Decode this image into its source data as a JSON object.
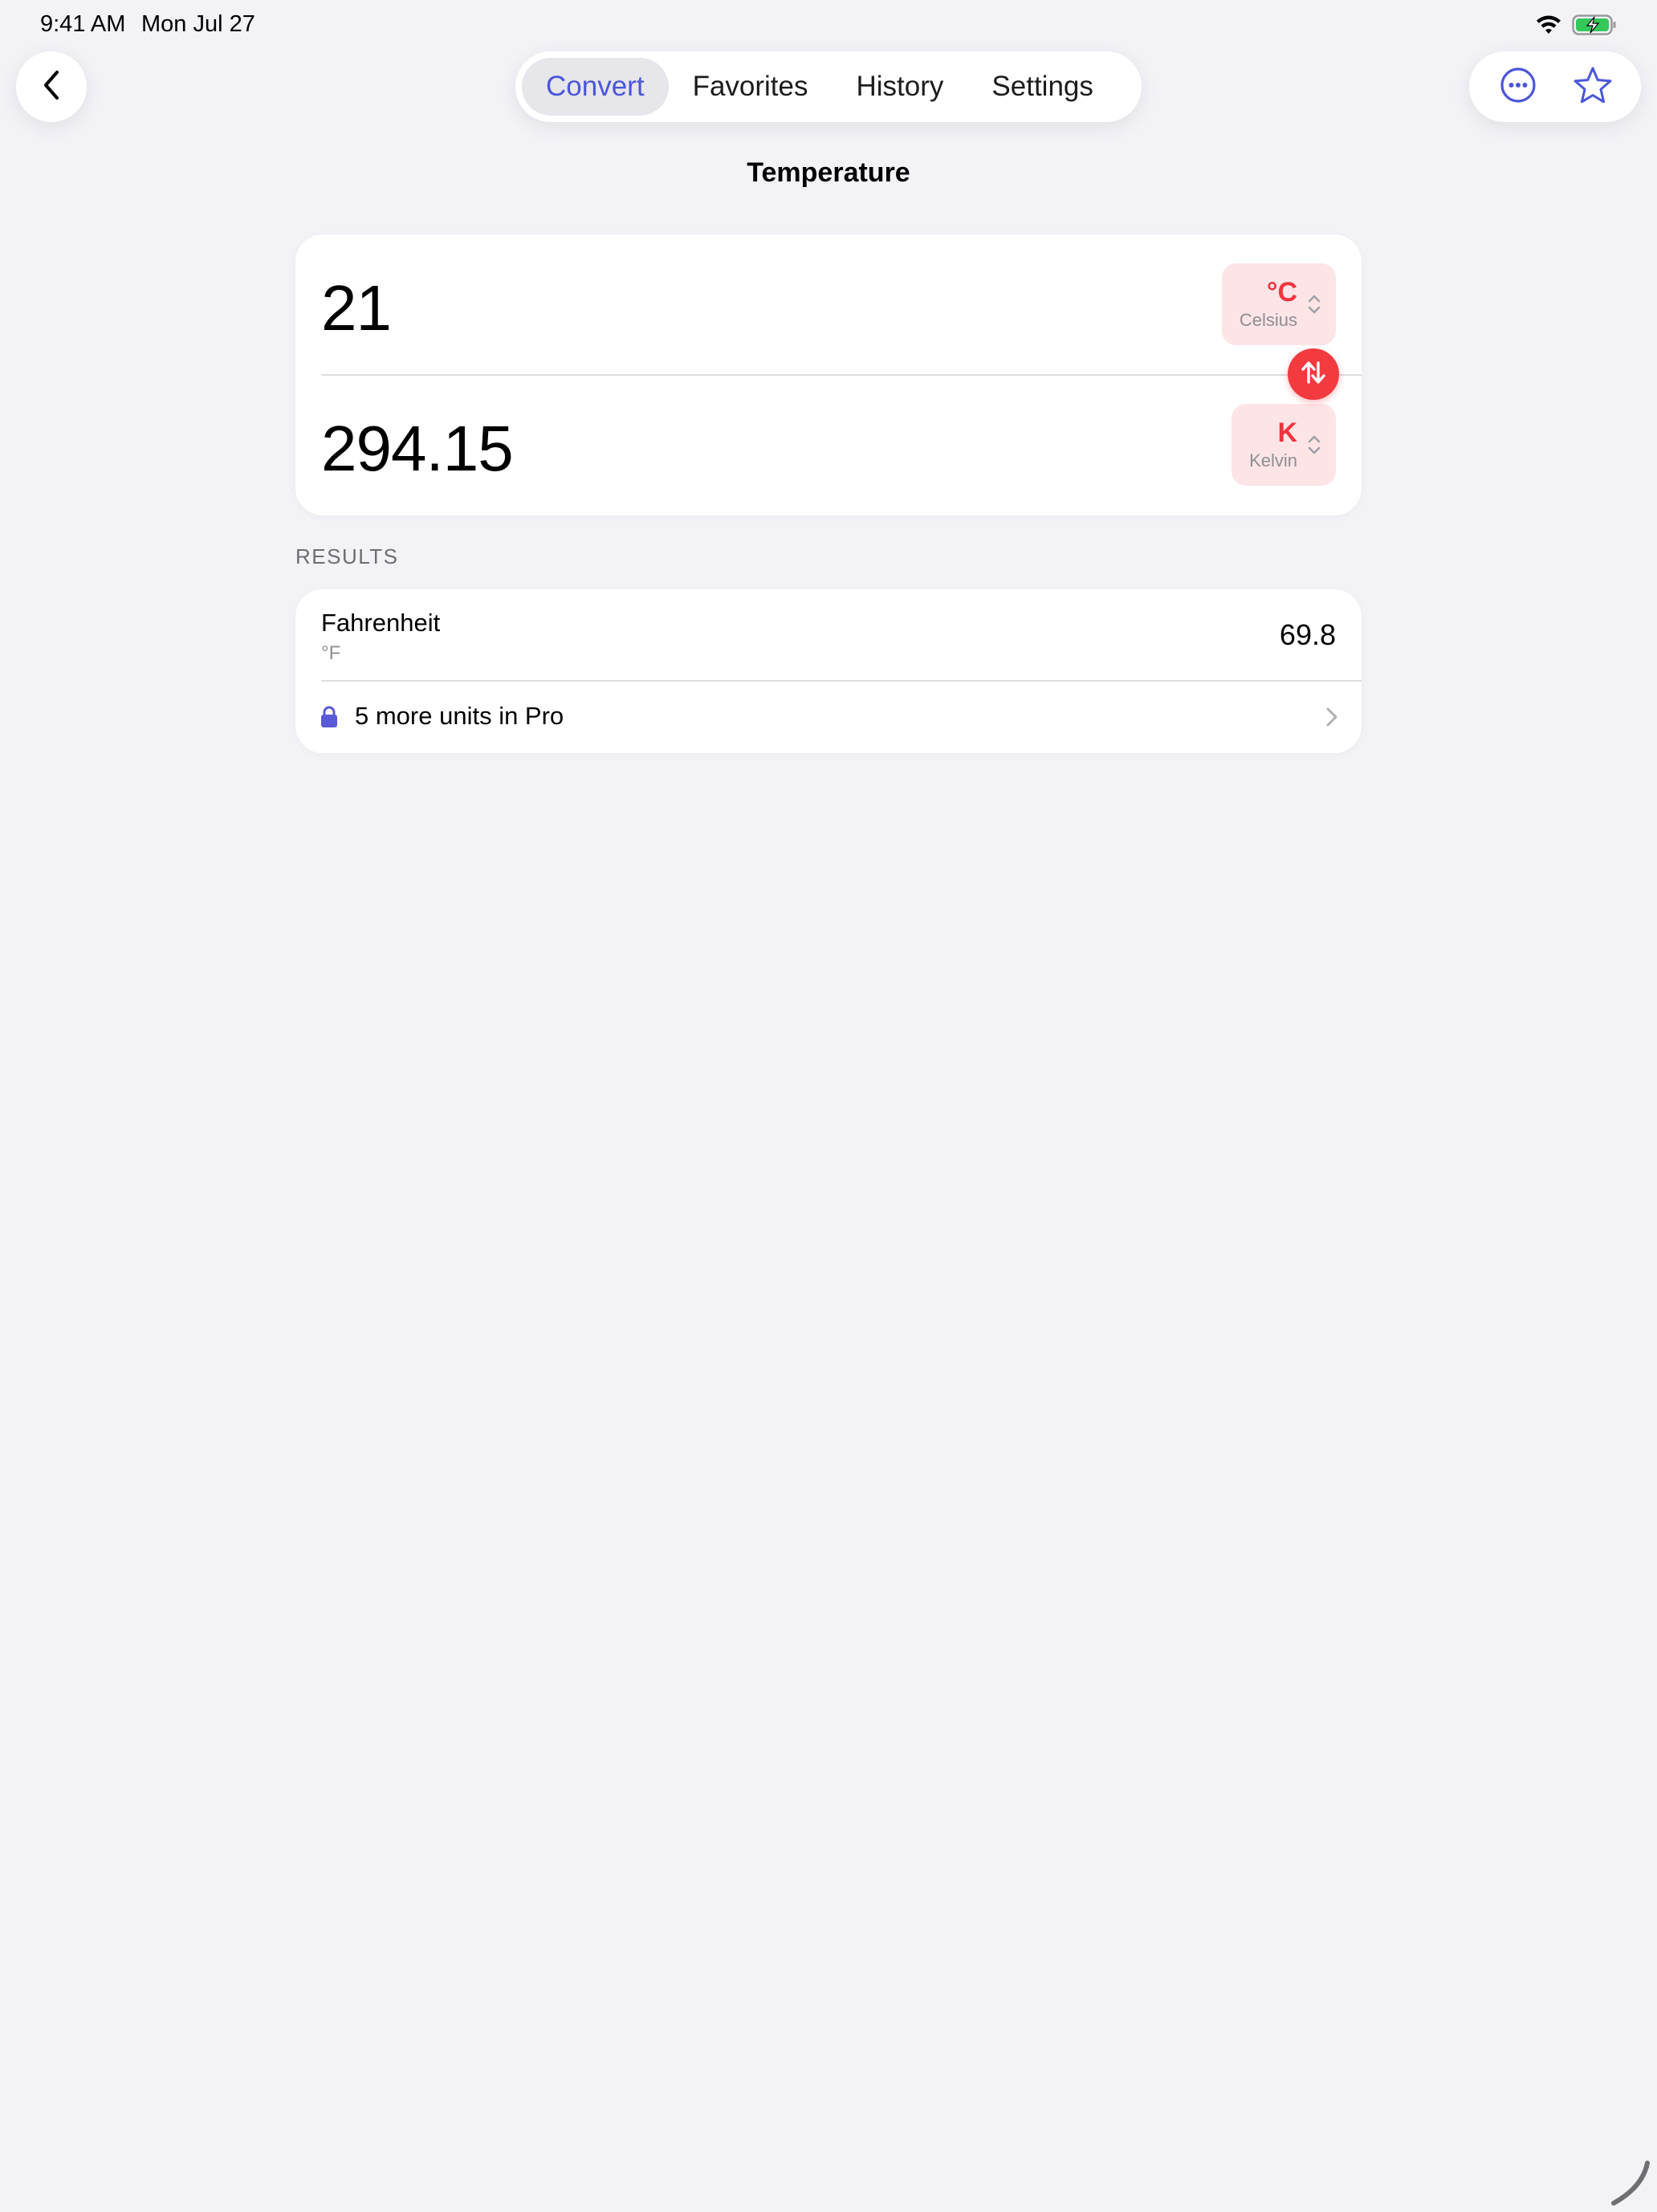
{
  "status_bar": {
    "time": "9:41 AM",
    "date": "Mon Jul 27"
  },
  "nav": {
    "tabs": [
      {
        "label": "Convert",
        "active": true
      },
      {
        "label": "Favorites",
        "active": false
      },
      {
        "label": "History",
        "active": false
      },
      {
        "label": "Settings",
        "active": false
      }
    ],
    "back_icon": "chevron-left-icon",
    "more_icon": "ellipsis-circle-icon",
    "favorite_icon": "star-icon"
  },
  "page": {
    "title": "Temperature"
  },
  "converter": {
    "input": {
      "value": "21",
      "unit_symbol": "°C",
      "unit_name": "Celsius"
    },
    "output": {
      "value": "294.15",
      "unit_symbol": "K",
      "unit_name": "Kelvin"
    },
    "swap_icon": "arrow-up-down-icon"
  },
  "results": {
    "header": "RESULTS",
    "items": [
      {
        "name": "Fahrenheit",
        "symbol": "°F",
        "value": "69.8"
      }
    ],
    "pro_row": {
      "label": "5 more units in Pro",
      "icon": "lock-icon"
    }
  },
  "colors": {
    "accent": "#4a56d8",
    "unit_red": "#f2343f",
    "chip_bg": "#fde4e6",
    "background": "#f2f2f7"
  }
}
